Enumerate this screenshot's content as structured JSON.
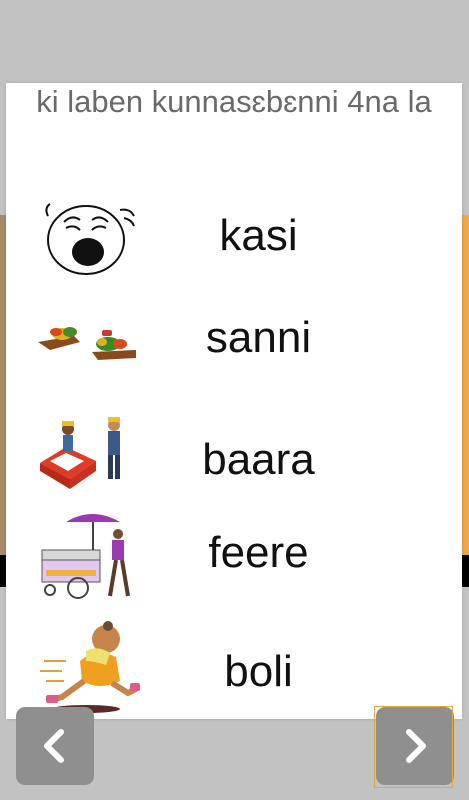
{
  "prompt": "ki laben kunnasɛbɛnni 4na la",
  "options": [
    {
      "word": "kasi",
      "icon": "crying-face-icon"
    },
    {
      "word": "sanni",
      "icon": "hands-trading-goods-icon"
    },
    {
      "word": "baara",
      "icon": "bricklayers-working-icon"
    },
    {
      "word": "feere",
      "icon": "street-vendor-cart-icon"
    },
    {
      "word": "boli",
      "icon": "running-child-icon"
    }
  ],
  "navigation": {
    "back_icon": "chevron-left-icon",
    "next_icon": "chevron-right-icon"
  },
  "colors": {
    "background": "#c2c2c2",
    "card": "#ffffff",
    "nav_button": "#8f8f8f",
    "highlight": "#e6a63a"
  }
}
